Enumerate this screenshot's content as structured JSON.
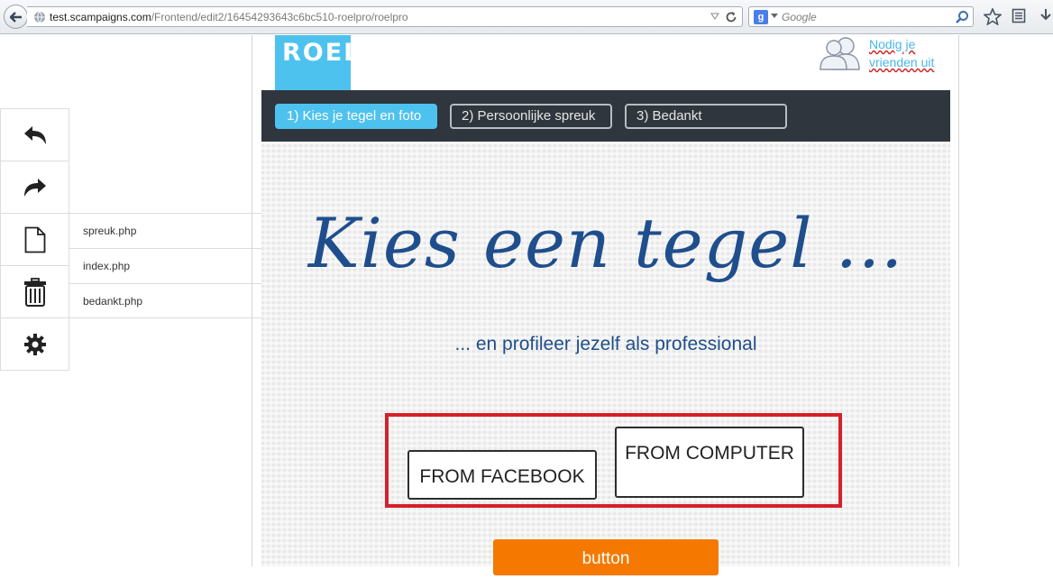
{
  "browser": {
    "url_domain": "test.scampaigns.com",
    "url_prefix": "",
    "url_path": "/Frontend/edit2/16454293643c6bc510-roelpro/roelpro",
    "search_placeholder": "Google",
    "search_engine_icon": "google-icon"
  },
  "toolbar": {
    "tools": [
      {
        "name": "undo-icon"
      },
      {
        "name": "redo-icon"
      },
      {
        "name": "file-icon"
      },
      {
        "name": "trash-icon"
      },
      {
        "name": "gear-icon"
      }
    ],
    "files": [
      "spreuk.php",
      "index.php",
      "bedankt.php"
    ]
  },
  "page": {
    "logo": "ROEL",
    "invite_text": "Nodig je vrienden uit",
    "steps": [
      "1) Kies je tegel en foto",
      "2) Persoonlijke spreuk",
      "3) Bedankt"
    ],
    "headline": "Kies een tegel ...",
    "subline": "... en profileer jezelf als professional",
    "btn_facebook": "FROM FACEBOOK",
    "btn_computer": "FROM COMPUTER",
    "btn_orange": "button"
  },
  "colors": {
    "accent": "#4ec2ee",
    "nav_bg": "#2f363d",
    "headline": "#1f4e8c",
    "highlight_frame": "#d6202a",
    "button_orange": "#f57900"
  }
}
